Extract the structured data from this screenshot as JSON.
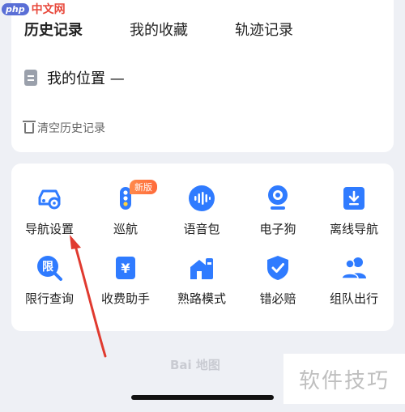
{
  "watermark_top": {
    "php": "php",
    "site": "中文网"
  },
  "tabs": [
    {
      "label": "历史记录",
      "active": true
    },
    {
      "label": "我的收藏",
      "active": false
    },
    {
      "label": "轨迹记录",
      "active": false
    }
  ],
  "history": {
    "item": "我的位置 —",
    "clear_label": "清空历史记录"
  },
  "tools": {
    "new_badge": "新版",
    "items": [
      {
        "label": "导航设置",
        "icon": "car-settings-icon"
      },
      {
        "label": "巡航",
        "icon": "traffic-light-icon"
      },
      {
        "label": "语音包",
        "icon": "voice-wave-icon"
      },
      {
        "label": "电子狗",
        "icon": "camera-icon"
      },
      {
        "label": "离线导航",
        "icon": "download-icon"
      },
      {
        "label": "限行查询",
        "icon": "restriction-search-icon"
      },
      {
        "label": "收费助手",
        "icon": "toll-yuan-icon"
      },
      {
        "label": "熟路模式",
        "icon": "home-route-icon"
      },
      {
        "label": "错必赔",
        "icon": "shield-check-icon"
      },
      {
        "label": "组队出行",
        "icon": "group-icon"
      }
    ]
  },
  "bottom_logo": "Bai 地图",
  "watermark_bottom": "软件技巧",
  "colors": {
    "accent": "#2f7bff",
    "annotation_arrow": "#e03a2f"
  }
}
